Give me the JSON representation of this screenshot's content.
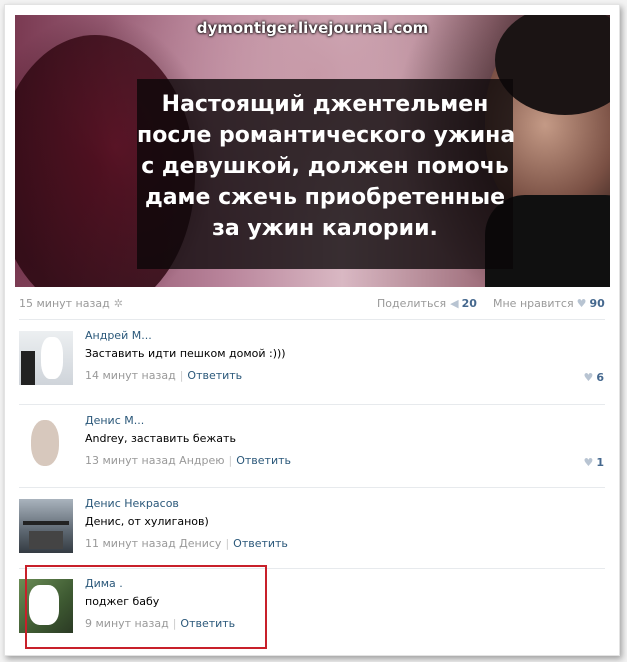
{
  "watermark": "dymontiger.livejournal.com",
  "caption_lines": [
    "Настоящий джентельмен",
    "после романтического ужина",
    "с девушкой, должен помочь",
    "даме сжечь приобретенные",
    "за ужин калории."
  ],
  "post": {
    "time": "15 минут назад",
    "share_label": "Поделиться",
    "share_count": "20",
    "like_label": "Мне нравится",
    "like_count": "90"
  },
  "comments": [
    {
      "author": "Андрей М...",
      "text": "Заставить идти пешком домой :)))",
      "time": "14 минут назад",
      "reply_label": "Ответить",
      "likes": "6"
    },
    {
      "author": "Денис М...",
      "text": "Andrey, заставить бежать",
      "time": "13 минут назад Андрею",
      "reply_label": "Ответить",
      "likes": "1"
    },
    {
      "author": "Денис Некрасов",
      "text": "Денис, от хулиганов)",
      "time": "11 минут назад Денису",
      "reply_label": "Ответить",
      "likes": ""
    },
    {
      "author": "Дима .",
      "text": "поджег бабу",
      "time": "9 минут назад",
      "reply_label": "Ответить",
      "likes": ""
    }
  ],
  "colors": {
    "link": "#2b587a",
    "muted": "#999999",
    "highlight_border": "#c8202a"
  },
  "icons": {
    "settings": "gear-icon",
    "share": "megaphone-icon",
    "like": "heart-icon"
  }
}
